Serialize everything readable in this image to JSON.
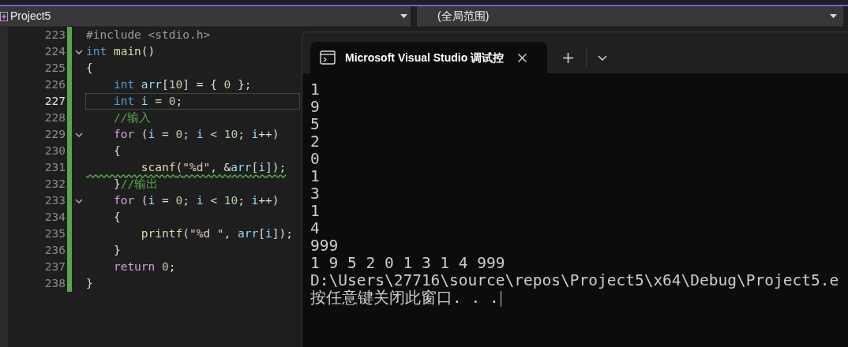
{
  "nav_bar": {
    "project": "Project5",
    "scope": "(全局范围)"
  },
  "editor": {
    "lines": [
      {
        "number": "223",
        "selected": false,
        "foldable": false,
        "warning": false,
        "tokens": [
          {
            "kind": "directive",
            "text": "#include <stdio.h>"
          }
        ]
      },
      {
        "number": "224",
        "selected": false,
        "foldable": true,
        "warning": false,
        "tokens": [
          {
            "kind": "type",
            "text": "int"
          },
          {
            "kind": "func",
            "text": " main"
          },
          {
            "kind": "plain",
            "text": "()"
          }
        ]
      },
      {
        "number": "225",
        "selected": false,
        "foldable": false,
        "warning": false,
        "tokens": [
          {
            "kind": "plain",
            "text": "{"
          }
        ]
      },
      {
        "number": "226",
        "selected": false,
        "foldable": false,
        "warning": false,
        "tokens": [
          {
            "kind": "type",
            "text": "    int"
          },
          {
            "kind": "var",
            "text": " arr"
          },
          {
            "kind": "plain",
            "text": "["
          },
          {
            "kind": "num",
            "text": "10"
          },
          {
            "kind": "plain",
            "text": "] = {"
          },
          {
            "kind": "num",
            "text": " 0"
          },
          {
            "kind": "plain",
            "text": " };"
          }
        ]
      },
      {
        "number": "227",
        "selected": true,
        "foldable": false,
        "warning": false,
        "tokens": [
          {
            "kind": "type",
            "text": "    int"
          },
          {
            "kind": "var",
            "text": " i"
          },
          {
            "kind": "plain",
            "text": " ="
          },
          {
            "kind": "num",
            "text": " 0"
          },
          {
            "kind": "plain",
            "text": ";"
          }
        ]
      },
      {
        "number": "228",
        "selected": false,
        "foldable": false,
        "warning": false,
        "tokens": [
          {
            "kind": "comment",
            "text": "    //输入"
          }
        ]
      },
      {
        "number": "229",
        "selected": false,
        "foldable": true,
        "warning": false,
        "tokens": [
          {
            "kind": "keyword",
            "text": "    for"
          },
          {
            "kind": "plain",
            "text": " ("
          },
          {
            "kind": "var",
            "text": "i"
          },
          {
            "kind": "plain",
            "text": " ="
          },
          {
            "kind": "num",
            "text": " 0"
          },
          {
            "kind": "plain",
            "text": ";"
          },
          {
            "kind": "var",
            "text": " i"
          },
          {
            "kind": "plain",
            "text": " <"
          },
          {
            "kind": "num",
            "text": " 10"
          },
          {
            "kind": "plain",
            "text": ";"
          },
          {
            "kind": "var",
            "text": " i"
          },
          {
            "kind": "plain",
            "text": "++)"
          }
        ]
      },
      {
        "number": "230",
        "selected": false,
        "foldable": false,
        "warning": false,
        "tokens": [
          {
            "kind": "plain",
            "text": "    {"
          }
        ]
      },
      {
        "number": "231",
        "selected": false,
        "foldable": false,
        "warning": true,
        "tokens": [
          {
            "kind": "func",
            "text": "        scanf"
          },
          {
            "kind": "plain",
            "text": "("
          },
          {
            "kind": "string",
            "text": "\"%d\""
          },
          {
            "kind": "plain",
            "text": ", &"
          },
          {
            "kind": "var",
            "text": "arr"
          },
          {
            "kind": "plain",
            "text": "["
          },
          {
            "kind": "var",
            "text": "i"
          },
          {
            "kind": "plain",
            "text": "]);"
          }
        ]
      },
      {
        "number": "232",
        "selected": false,
        "foldable": false,
        "warning": false,
        "tokens": [
          {
            "kind": "plain",
            "text": "    }"
          },
          {
            "kind": "comment",
            "text": "//输出"
          }
        ]
      },
      {
        "number": "233",
        "selected": false,
        "foldable": true,
        "warning": false,
        "tokens": [
          {
            "kind": "keyword",
            "text": "    for"
          },
          {
            "kind": "plain",
            "text": " ("
          },
          {
            "kind": "var",
            "text": "i"
          },
          {
            "kind": "plain",
            "text": " ="
          },
          {
            "kind": "num",
            "text": " 0"
          },
          {
            "kind": "plain",
            "text": ";"
          },
          {
            "kind": "var",
            "text": " i"
          },
          {
            "kind": "plain",
            "text": " <"
          },
          {
            "kind": "num",
            "text": " 10"
          },
          {
            "kind": "plain",
            "text": ";"
          },
          {
            "kind": "var",
            "text": " i"
          },
          {
            "kind": "plain",
            "text": "++)"
          }
        ]
      },
      {
        "number": "234",
        "selected": false,
        "foldable": false,
        "warning": false,
        "tokens": [
          {
            "kind": "plain",
            "text": "    {"
          }
        ]
      },
      {
        "number": "235",
        "selected": false,
        "foldable": false,
        "warning": false,
        "tokens": [
          {
            "kind": "func",
            "text": "        printf"
          },
          {
            "kind": "plain",
            "text": "("
          },
          {
            "kind": "string",
            "text": "\"%d \""
          },
          {
            "kind": "plain",
            "text": ","
          },
          {
            "kind": "var",
            "text": " arr"
          },
          {
            "kind": "plain",
            "text": "["
          },
          {
            "kind": "var",
            "text": "i"
          },
          {
            "kind": "plain",
            "text": "]);"
          }
        ]
      },
      {
        "number": "236",
        "selected": false,
        "foldable": false,
        "warning": false,
        "tokens": [
          {
            "kind": "plain",
            "text": "    }"
          }
        ]
      },
      {
        "number": "237",
        "selected": false,
        "foldable": false,
        "warning": false,
        "tokens": [
          {
            "kind": "keyword",
            "text": "    return"
          },
          {
            "kind": "num",
            "text": " 0"
          },
          {
            "kind": "plain",
            "text": ";"
          }
        ]
      },
      {
        "number": "238",
        "selected": false,
        "foldable": false,
        "warning": false,
        "tokens": [
          {
            "kind": "plain",
            "text": "}"
          }
        ]
      }
    ]
  },
  "console": {
    "tab_title": "Microsoft Visual Studio 调试控",
    "output": [
      "1",
      "9",
      "5",
      "2",
      "0",
      "1",
      "3",
      "1",
      "4",
      "999",
      "1 9 5 2 0 1 3 1 4 999",
      "D:\\Users\\27716\\source\\repos\\Project5\\x64\\Debug\\Project5.e",
      "按任意键关闭此窗口. . ."
    ]
  }
}
